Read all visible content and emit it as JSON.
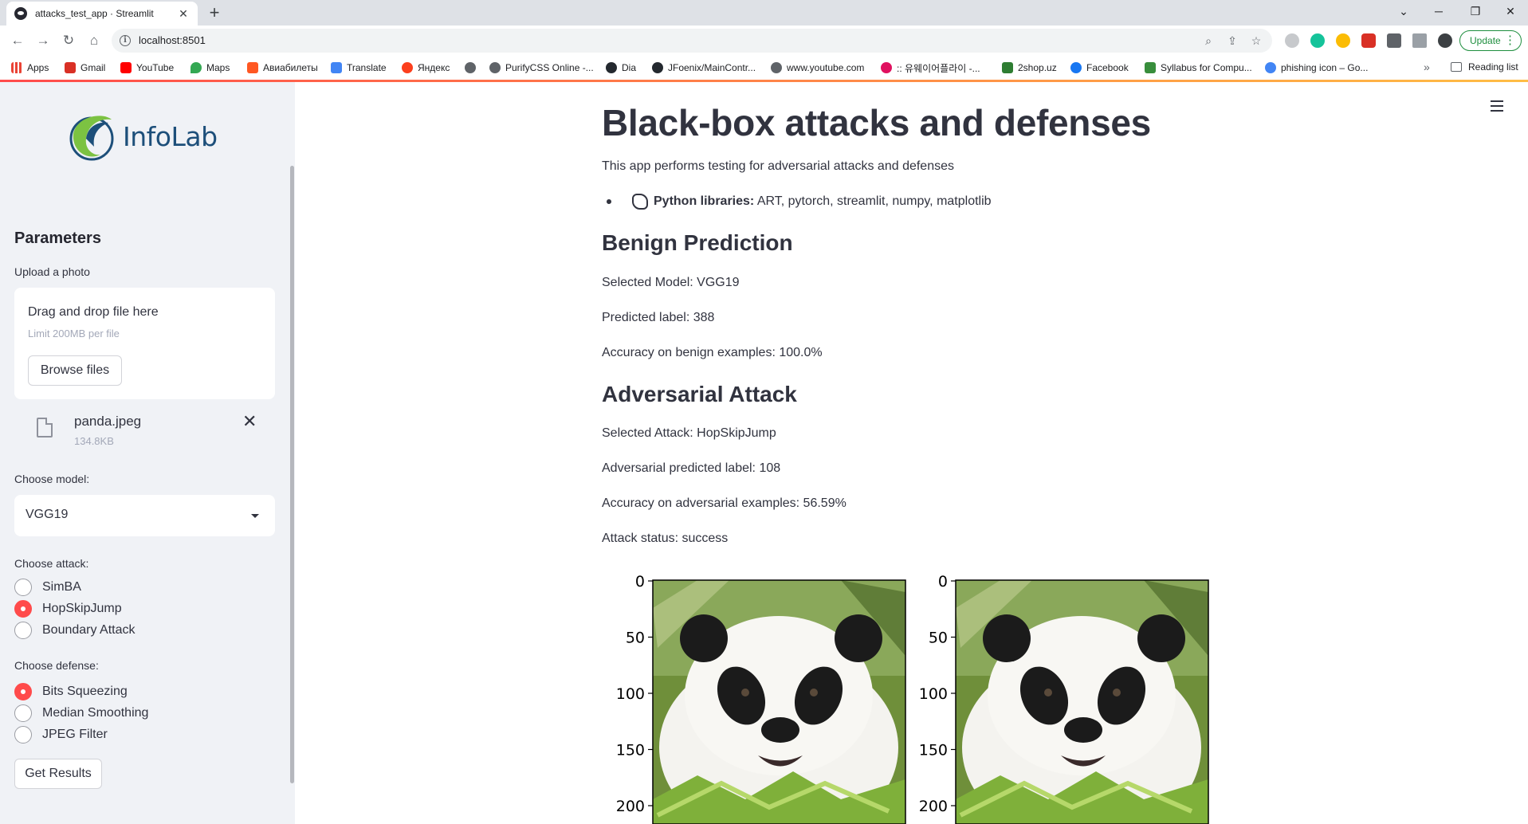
{
  "browser": {
    "tab_title": "attacks_test_app · Streamlit",
    "url": "localhost:8501",
    "update_label": "Update",
    "bookmarks": [
      {
        "label": "Apps",
        "color": "#ea4335"
      },
      {
        "label": "Gmail",
        "color": "#d93025"
      },
      {
        "label": "YouTube",
        "color": "#ff0000"
      },
      {
        "label": "Maps",
        "color": "#34a853"
      },
      {
        "label": "Авиабилеты",
        "color": "#ff5722"
      },
      {
        "label": "Translate",
        "color": "#4285f4"
      },
      {
        "label": "Яндекс",
        "color": "#fc3f1d"
      },
      {
        "label": "",
        "color": "#5f6368"
      },
      {
        "label": "PurifyCSS Online -...",
        "color": "#5f6368"
      },
      {
        "label": "Dia",
        "color": "#24292f"
      },
      {
        "label": "JFoenix/MainContr...",
        "color": "#24292f"
      },
      {
        "label": "www.youtube.com",
        "color": "#5f6368"
      },
      {
        "label": ":: 유웨이어플라이 -...",
        "color": "#e0115f"
      },
      {
        "label": "2shop.uz",
        "color": "#2e7d32"
      },
      {
        "label": "Facebook",
        "color": "#1877f2"
      },
      {
        "label": "Syllabus for Compu...",
        "color": "#388e3c"
      },
      {
        "label": "phishing icon – Go...",
        "color": "#4285f4"
      }
    ],
    "reading_list": "Reading list"
  },
  "sidebar": {
    "logo_text": "InfoLab",
    "title": "Parameters",
    "upload_label": "Upload a photo",
    "drop_title": "Drag and drop file here",
    "drop_limit": "Limit 200MB per file",
    "browse_label": "Browse files",
    "file_name": "panda.jpeg",
    "file_size": "134.8KB",
    "model_label": "Choose model:",
    "model_value": "VGG19",
    "attack_label": "Choose attack:",
    "attacks": [
      {
        "label": "SimBA",
        "selected": false
      },
      {
        "label": "HopSkipJump",
        "selected": true
      },
      {
        "label": "Boundary Attack",
        "selected": false
      }
    ],
    "defense_label": "Choose defense:",
    "defenses": [
      {
        "label": "Bits Squeezing",
        "selected": true
      },
      {
        "label": "Median Smoothing",
        "selected": false
      },
      {
        "label": "JPEG Filter",
        "selected": false
      }
    ],
    "get_results_label": "Get Results"
  },
  "main": {
    "title": "Black-box attacks and defenses",
    "intro": "This app performs testing for adversarial attacks and defenses",
    "libs_bold": "Python libraries:",
    "libs_text": " ART, pytorch, streamlit, numpy, matplotlib",
    "benign_heading": "Benign Prediction",
    "selected_model": "Selected Model: VGG19",
    "predicted_label": "Predicted label: 388",
    "benign_accuracy": "Accuracy on benign examples: 100.0%",
    "adv_heading": "Adversarial Attack",
    "selected_attack": "Selected Attack: HopSkipJump",
    "adv_label": "Adversarial predicted label: 108",
    "adv_accuracy": "Accuracy on adversarial examples: 56.59%",
    "attack_status": "Attack status: success",
    "figure_yticks": [
      "0",
      "50",
      "100",
      "150",
      "200"
    ]
  }
}
